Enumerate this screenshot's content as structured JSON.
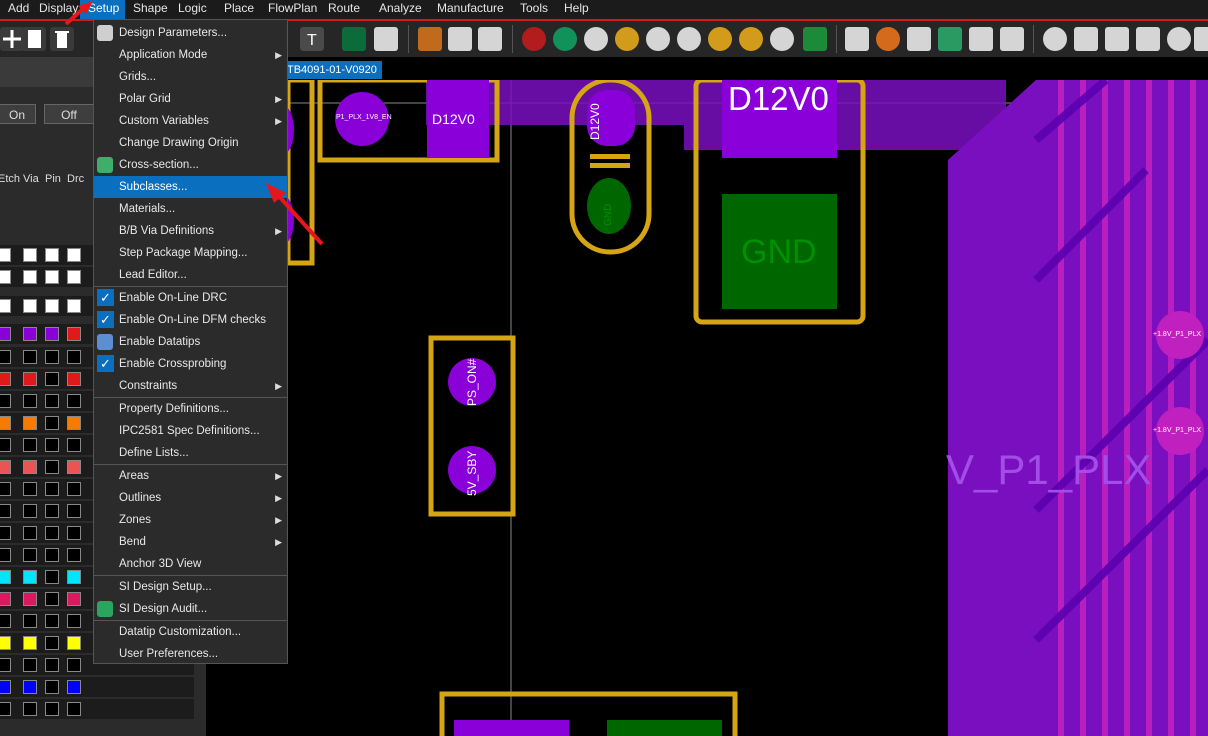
{
  "menubar": {
    "items": [
      "Add",
      "Display",
      "Setup",
      "Shape",
      "Logic",
      "Place",
      "FlowPlan",
      "Route",
      "Analyze",
      "Manufacture",
      "Tools",
      "Help"
    ],
    "active": "Setup"
  },
  "tab": {
    "title": "TB4091-01-V0920"
  },
  "left_panel": {
    "btn_on": "On",
    "btn_off": "Off",
    "columns": [
      "Etch",
      "Via",
      "Pin",
      "Drc"
    ]
  },
  "setup_menu": {
    "items": [
      {
        "label": "Design Parameters...",
        "icon": "gear-icon"
      },
      {
        "label": "Application Mode",
        "submenu": true
      },
      {
        "label": "Grids..."
      },
      {
        "label": "Polar Grid",
        "submenu": true
      },
      {
        "label": "Custom Variables",
        "submenu": true
      },
      {
        "label": "Change Drawing Origin"
      },
      {
        "label": "Cross-section...",
        "icon": "layer-stack-icon"
      },
      {
        "label": "Subclasses...",
        "highlighted": true
      },
      {
        "label": "Materials..."
      },
      {
        "label": "B/B Via Definitions",
        "submenu": true
      },
      {
        "label": "Step Package Mapping..."
      },
      {
        "label": "Lead Editor..."
      },
      {
        "label": "Enable On-Line DRC",
        "checked": true
      },
      {
        "label": "Enable On-Line DFM checks",
        "checked": true
      },
      {
        "label": "Enable Datatips",
        "icon": "datatip-icon"
      },
      {
        "label": "Enable Crossprobing",
        "checked": true
      },
      {
        "label": "Constraints",
        "submenu": true
      },
      {
        "label": "Property Definitions..."
      },
      {
        "label": "IPC2581 Spec Definitions..."
      },
      {
        "label": "Define Lists..."
      },
      {
        "label": "Areas",
        "submenu": true
      },
      {
        "label": "Outlines",
        "submenu": true
      },
      {
        "label": "Zones",
        "submenu": true
      },
      {
        "label": "Bend",
        "submenu": true
      },
      {
        "label": "Anchor 3D View"
      },
      {
        "label": "SI Design Setup..."
      },
      {
        "label": "SI Design Audit...",
        "icon": "audit-icon"
      },
      {
        "label": "Datatip Customization..."
      },
      {
        "label": "User Preferences..."
      }
    ],
    "arrow_glyph": "▶",
    "check_glyph": "✓"
  },
  "canvas": {
    "net_labels": {
      "p1_plx": "P1_PLX_1V8_EN",
      "d12v0_pad": "D12V0",
      "d12v0_vertical": "D12V0",
      "d12v0_large": "D12V0",
      "gnd_pad": "GND",
      "gnd_large": "GND",
      "ps_on": "PS_ON#",
      "sby": "5V_SBY",
      "big_net": "V_P1_PLX",
      "small_net_1": "+1.8V_P1_PLX",
      "small_net_2": "+1.8V_P1_PLX"
    }
  },
  "colors": {
    "menubar_active": "#0a6fbf",
    "accent_red": "#d11a1a",
    "outline_gold": "#d6a514",
    "pad_purple": "#8a00d8",
    "copper_green": "#006600"
  }
}
